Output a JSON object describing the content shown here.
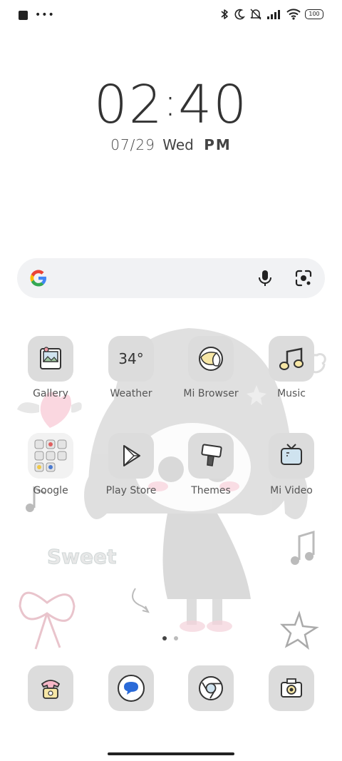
{
  "status_bar": {
    "battery": "100",
    "icons": [
      "bluetooth-icon",
      "moon-icon",
      "bell-off-icon",
      "signal-icon",
      "wifi-icon",
      "battery-icon"
    ]
  },
  "clock": {
    "hours": "02",
    "minutes": "40",
    "date": "07/29",
    "weekday": "Wed",
    "ampm": "PM"
  },
  "search": {
    "icons": [
      "google-g-icon",
      "microphone-icon",
      "lens-icon"
    ]
  },
  "apps": [
    {
      "label": "Gallery",
      "icon": "photo-frame-icon"
    },
    {
      "label": "Weather",
      "icon": "weather-icon",
      "value": "34°"
    },
    {
      "label": "Mi Browser",
      "icon": "browser-icon"
    },
    {
      "label": "Music",
      "icon": "music-note-icon"
    },
    {
      "label": "Google",
      "icon": "folder-icon"
    },
    {
      "label": "Play Store",
      "icon": "play-store-icon"
    },
    {
      "label": "Themes",
      "icon": "paint-brush-icon"
    },
    {
      "label": "Mi Video",
      "icon": "tv-icon"
    }
  ],
  "dock": [
    {
      "icon": "phone-icon"
    },
    {
      "icon": "messages-icon"
    },
    {
      "icon": "chrome-icon"
    },
    {
      "icon": "camera-icon"
    }
  ],
  "pager": {
    "pages": 2,
    "current": 1
  },
  "wallpaper": {
    "text": "Sweet"
  },
  "colors": {
    "tile": "#dcdcdc",
    "search_bg": "#f1f2f4",
    "accent_yellow": "#f7e7a6",
    "accent_pink": "#f6b7c7",
    "accent_blue": "#2a6ad8"
  }
}
